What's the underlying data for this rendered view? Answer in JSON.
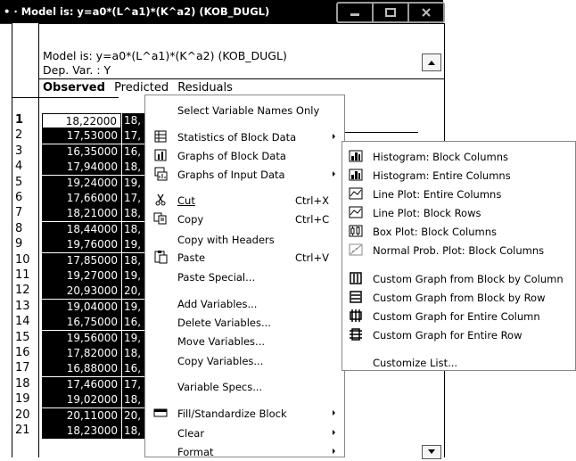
{
  "window": {
    "title": "• · Model is: y=a0*(L^a1)*(K^a2) (KOB_DUGL)"
  },
  "sheet": {
    "header_line1": "Model is:  y=a0*(L^a1)*(K^a2) (KOB_DUGL)",
    "header_line2": "Dep. Var. : Y",
    "tabs": [
      {
        "label": "Observed"
      },
      {
        "label": "Predicted"
      },
      {
        "label": "Residuals"
      }
    ],
    "rows": [
      {
        "num": "1",
        "observed": "18,22000",
        "predicted": "18,"
      },
      {
        "num": "2",
        "observed": "17,53000",
        "predicted": "17,"
      },
      {
        "num": "3",
        "observed": "16,35000",
        "predicted": "16,"
      },
      {
        "num": "4",
        "observed": "17,94000",
        "predicted": "18,"
      },
      {
        "num": "5",
        "observed": "19,24000",
        "predicted": "19,"
      },
      {
        "num": "6",
        "observed": "17,66000",
        "predicted": "17,"
      },
      {
        "num": "7",
        "observed": "18,21000",
        "predicted": "18,"
      },
      {
        "num": "8",
        "observed": "18,44000",
        "predicted": "18,"
      },
      {
        "num": "9",
        "observed": "19,76000",
        "predicted": "19,"
      },
      {
        "num": "10",
        "observed": "17,85000",
        "predicted": "18,"
      },
      {
        "num": "11",
        "observed": "19,27000",
        "predicted": "19,"
      },
      {
        "num": "12",
        "observed": "20,93000",
        "predicted": "20,"
      },
      {
        "num": "13",
        "observed": "19,04000",
        "predicted": "19,"
      },
      {
        "num": "14",
        "observed": "16,75000",
        "predicted": "16,"
      },
      {
        "num": "15",
        "observed": "19,56000",
        "predicted": "19,"
      },
      {
        "num": "16",
        "observed": "17,82000",
        "predicted": "18,"
      },
      {
        "num": "17",
        "observed": "16,88000",
        "predicted": "16,"
      },
      {
        "num": "18",
        "observed": "17,46000",
        "predicted": "17,"
      },
      {
        "num": "19",
        "observed": "19,02000",
        "predicted": "18,"
      },
      {
        "num": "20",
        "observed": "20,11000",
        "predicted": "20,"
      },
      {
        "num": "21",
        "observed": "18,23000",
        "predicted": "18,"
      }
    ]
  },
  "context_menu": {
    "items": [
      {
        "label": "Select Variable Names Only",
        "shortcut": "",
        "submenu": false,
        "icon": "none"
      },
      {
        "label": "Statistics of Block Data",
        "shortcut": "",
        "submenu": true,
        "icon": "stats-table-icon"
      },
      {
        "label": "Graphs of Block Data",
        "shortcut": "",
        "submenu": true,
        "icon": "block-graph-icon"
      },
      {
        "label": "Graphs of Input Data",
        "shortcut": "",
        "submenu": true,
        "icon": "input-graph-icon"
      },
      {
        "label": "Cut",
        "shortcut": "Ctrl+X",
        "submenu": false,
        "icon": "scissors-icon"
      },
      {
        "label": "Copy",
        "shortcut": "Ctrl+C",
        "submenu": false,
        "icon": "copy-icon"
      },
      {
        "label": "Copy with Headers",
        "shortcut": "",
        "submenu": false,
        "icon": "none"
      },
      {
        "label": "Paste",
        "shortcut": "Ctrl+V",
        "submenu": false,
        "icon": "paste-icon"
      },
      {
        "label": "Paste Special...",
        "shortcut": "",
        "submenu": false,
        "icon": "none"
      },
      {
        "label": "Add Variables...",
        "shortcut": "",
        "submenu": false,
        "icon": "none"
      },
      {
        "label": "Delete Variables...",
        "shortcut": "",
        "submenu": false,
        "icon": "none"
      },
      {
        "label": "Move Variables...",
        "shortcut": "",
        "submenu": false,
        "icon": "none"
      },
      {
        "label": "Copy Variables...",
        "shortcut": "",
        "submenu": false,
        "icon": "none"
      },
      {
        "label": "Variable Specs...",
        "shortcut": "",
        "submenu": false,
        "icon": "none"
      },
      {
        "label": "Fill/Standardize Block",
        "shortcut": "",
        "submenu": true,
        "icon": "fill-icon"
      },
      {
        "label": "Clear",
        "shortcut": "",
        "submenu": true,
        "icon": "none"
      },
      {
        "label": "Format",
        "shortcut": "",
        "submenu": true,
        "icon": "none"
      }
    ]
  },
  "submenu": {
    "items": [
      {
        "label": "Histogram: Block Columns",
        "icon": "histogram-icon"
      },
      {
        "label": "Histogram: Entire Columns",
        "icon": "histogram-icon"
      },
      {
        "label": "Line Plot: Entire Columns",
        "icon": "line-plot-icon"
      },
      {
        "label": "Line Plot: Block Rows",
        "icon": "line-plot-icon"
      },
      {
        "label": "Box Plot: Block Columns",
        "icon": "box-plot-icon"
      },
      {
        "label": "Normal Prob. Plot: Block Columns",
        "icon": "normal-prob-plot-icon"
      },
      {
        "label": "Custom Graph from Block by Column",
        "icon": "custom-graph-column-icon"
      },
      {
        "label": "Custom Graph from Block by Row",
        "icon": "custom-graph-row-icon"
      },
      {
        "label": "Custom Graph for Entire Column",
        "icon": "custom-graph-entire-column-icon"
      },
      {
        "label": "Custom Graph for Entire Row",
        "icon": "custom-graph-entire-row-icon"
      },
      {
        "label": "Customize List...",
        "icon": "none"
      }
    ]
  }
}
